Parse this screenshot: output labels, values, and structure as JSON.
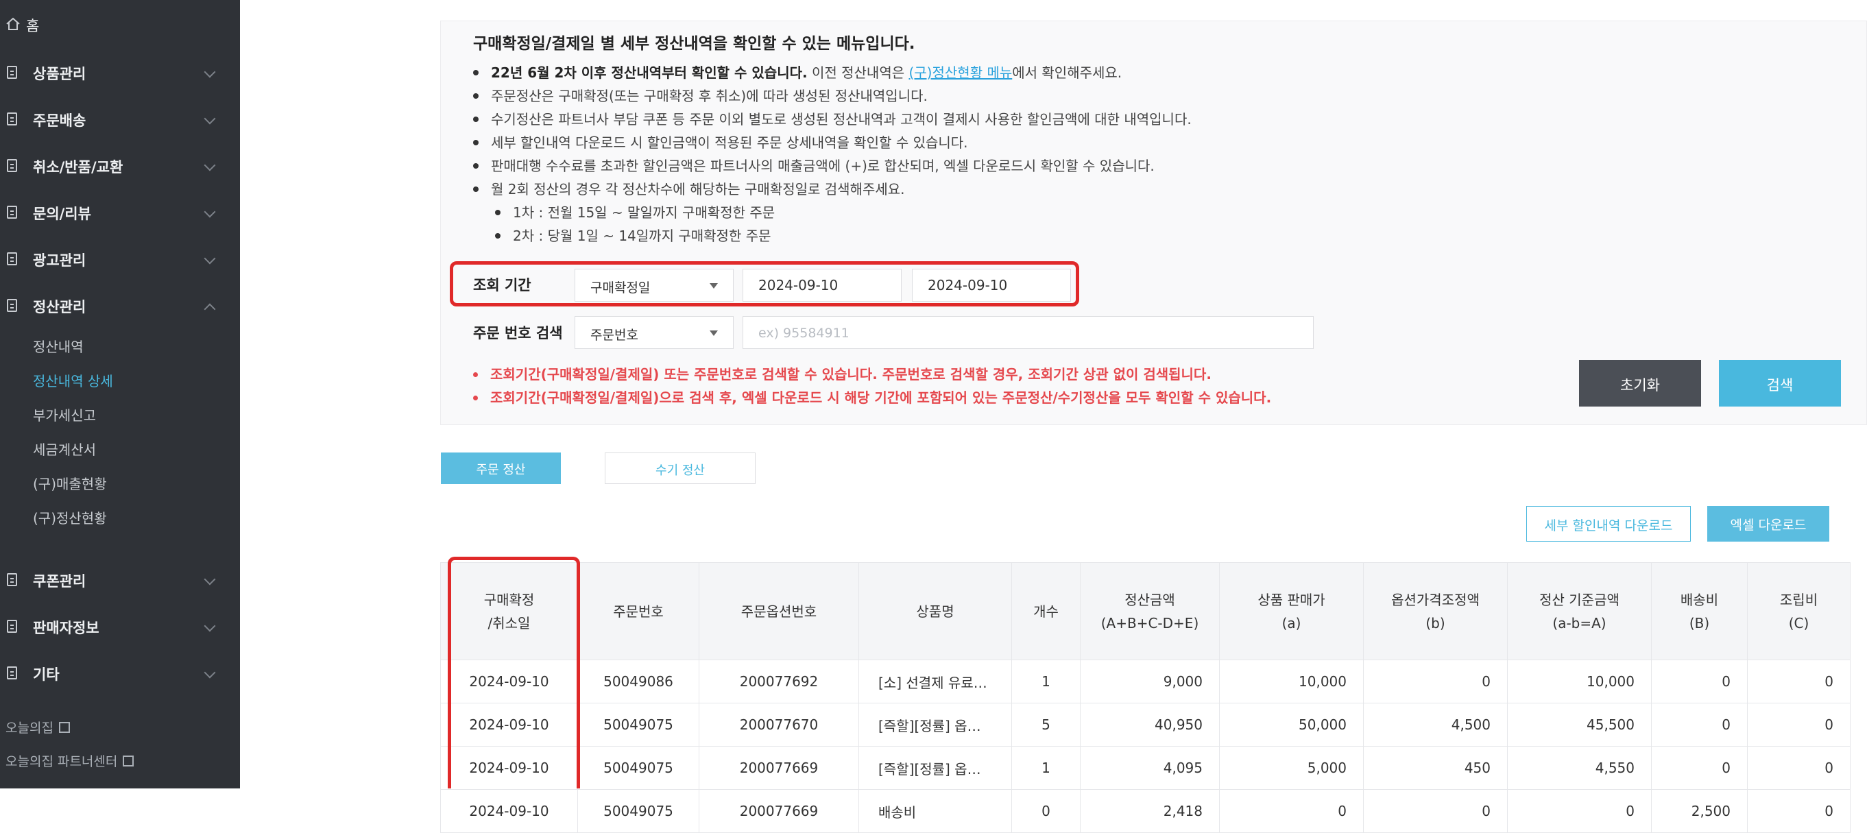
{
  "sidebar": {
    "home": "홈",
    "menus": [
      {
        "label": "상품관리"
      },
      {
        "label": "주문배송"
      },
      {
        "label": "취소/반품/교환"
      },
      {
        "label": "문의/리뷰"
      },
      {
        "label": "광고관리"
      },
      {
        "label": "정산관리"
      }
    ],
    "settlement_sub": [
      "정산내역",
      "정산내역 상세",
      "부가세신고",
      "세금계산서",
      "(구)매출현황",
      "(구)정산현황"
    ],
    "menus_after": [
      {
        "label": "쿠폰관리"
      },
      {
        "label": "판매자정보"
      },
      {
        "label": "기타"
      }
    ],
    "external_links": [
      "오늘의집",
      "오늘의집 파트너센터"
    ]
  },
  "notice": {
    "title": "구매확정일/결제일 별 세부 정산내역을 확인할 수 있는 메뉴입니다.",
    "line1_bold": "22년 6월 2차 이후 정산내역부터 확인할 수 있습니다.",
    "line1_pre": " 이전 정산내역은 ",
    "line1_link": "(구)정산현황 메뉴",
    "line1_post": "에서 확인해주세요.",
    "line2": "주문정산은 구매확정(또는 구매확정 후 취소)에 따라 생성된 정산내역입니다.",
    "line3": "수기정산은 파트너사 부담 쿠폰 등 주문 이외 별도로 생성된 정산내역과 고객이 결제시 사용한 할인금액에 대한 내역입니다.",
    "line4": "세부 할인내역 다운로드 시 할인금액이 적용된 주문 상세내역을 확인할 수 있습니다.",
    "line5": "판매대행 수수료를 초과한 할인금액은 파트너사의 매출금액에 (+)로 합산되며, 엑셀 다운로드시 확인할 수 있습니다.",
    "line6": "월 2회 정산의 경우 각 정산차수에 해당하는 구매확정일로 검색해주세요.",
    "sub1": "1차 : 전월 15일 ~ 말일까지 구매확정한 주문",
    "sub2": "2차 : 당월 1일 ~ 14일까지 구매확정한 주문"
  },
  "filter": {
    "period_label": "조회 기간",
    "period_type": "구매확정일",
    "date_from": "2024-09-10",
    "date_to": "2024-09-10",
    "order_label": "주문 번호 검색",
    "order_type": "주문번호",
    "order_placeholder": "ex) 95584911",
    "warn1": "조회기간(구매확정일/결제일) 또는 주문번호로 검색할 수 있습니다. 주문번호로 검색할 경우, 조회기간 상관 없이 검색됩니다.",
    "warn2": "조회기간(구매확정일/결제일)으로 검색 후, 엑셀 다운로드 시 해당 기간에 포함되어 있는 주문정산/수기정산을 모두 확인할 수 있습니다.",
    "reset_label": "초기화",
    "search_label": "검색"
  },
  "tabs": [
    "주문 정산",
    "수기 정산"
  ],
  "downloads": {
    "discount": "세부 할인내역 다운로드",
    "excel": "엑셀 다운로드"
  },
  "table": {
    "headers": [
      [
        "구매확정",
        "/취소일"
      ],
      [
        "주문번호"
      ],
      [
        "주문옵션번호"
      ],
      [
        "상품명"
      ],
      [
        "개수"
      ],
      [
        "정산금액",
        "(A+B+C-D+E)"
      ],
      [
        "상품 판매가",
        "(a)"
      ],
      [
        "옵션가격조정액",
        "(b)"
      ],
      [
        "정산 기준금액",
        "(a-b=A)"
      ],
      [
        "배송비",
        "(B)"
      ],
      [
        "조립비",
        "(C)"
      ]
    ],
    "rows": [
      [
        "2024-09-10",
        "50049086",
        "200077692",
        "[소] 선결제 유료…",
        "1",
        "9,000",
        "10,000",
        "0",
        "10,000",
        "0",
        "0"
      ],
      [
        "2024-09-10",
        "50049075",
        "200077670",
        "[즉할][정률] 옵…",
        "5",
        "40,950",
        "50,000",
        "4,500",
        "45,500",
        "0",
        "0"
      ],
      [
        "2024-09-10",
        "50049075",
        "200077669",
        "[즉할][정률] 옵…",
        "1",
        "4,095",
        "5,000",
        "450",
        "4,550",
        "0",
        "0"
      ],
      [
        "2024-09-10",
        "50049075",
        "200077669",
        "배송비",
        "0",
        "2,418",
        "0",
        "0",
        "0",
        "2,500",
        "0"
      ]
    ]
  },
  "colors": {
    "sidebar_bg": "#2f3237",
    "accent": "#49b8de",
    "highlight_red": "#e02929",
    "warning_red": "#e5484d",
    "reset_btn": "#4b4f56"
  }
}
